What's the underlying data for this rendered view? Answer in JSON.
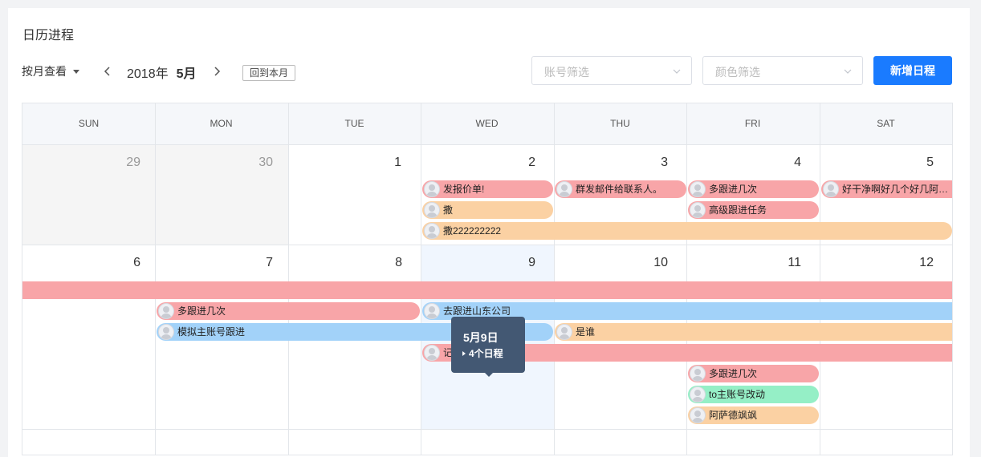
{
  "page_title": "日历进程",
  "toolbar": {
    "view_mode": "按月查看",
    "year": "2018年",
    "month": "5月",
    "today_button": "回到本月",
    "account_filter_placeholder": "账号筛选",
    "color_filter_placeholder": "颜色筛选",
    "new_button": "新增日程"
  },
  "weekdays": [
    "SUN",
    "MON",
    "TUE",
    "WED",
    "THU",
    "FRI",
    "SAT"
  ],
  "week1": {
    "days": [
      "29",
      "30",
      "1",
      "2",
      "3",
      "4",
      "5"
    ]
  },
  "week2": {
    "days": [
      "6",
      "7",
      "8",
      "9",
      "10",
      "11",
      "12"
    ]
  },
  "events": {
    "e1": "发报价单!",
    "e2": "群发邮件给联系人。",
    "e3": "多跟进几次",
    "e4": "好干净啊好几个好几阿…",
    "e5": "撒",
    "e6": "高级跟进任务",
    "e7": "撒222222222",
    "e8": "",
    "e9": "多跟进几次",
    "e10": "去跟进山东公司",
    "e11": "模拟主账号跟进",
    "e12": "是谁",
    "e13": "记",
    "e14": "多跟进几次",
    "e15": "to主账号改动",
    "e16": "阿萨德飒飒"
  },
  "colors": {
    "red": "#f8a5a8",
    "orange": "#fbd1a3",
    "blue": "#a2d2f9",
    "green": "#95efc6",
    "primary": "#1a7bff",
    "tooltip": "#435873",
    "today_bg": "#f0f6fe"
  },
  "tooltip": {
    "date": "5月9日",
    "count": "4个日程"
  }
}
